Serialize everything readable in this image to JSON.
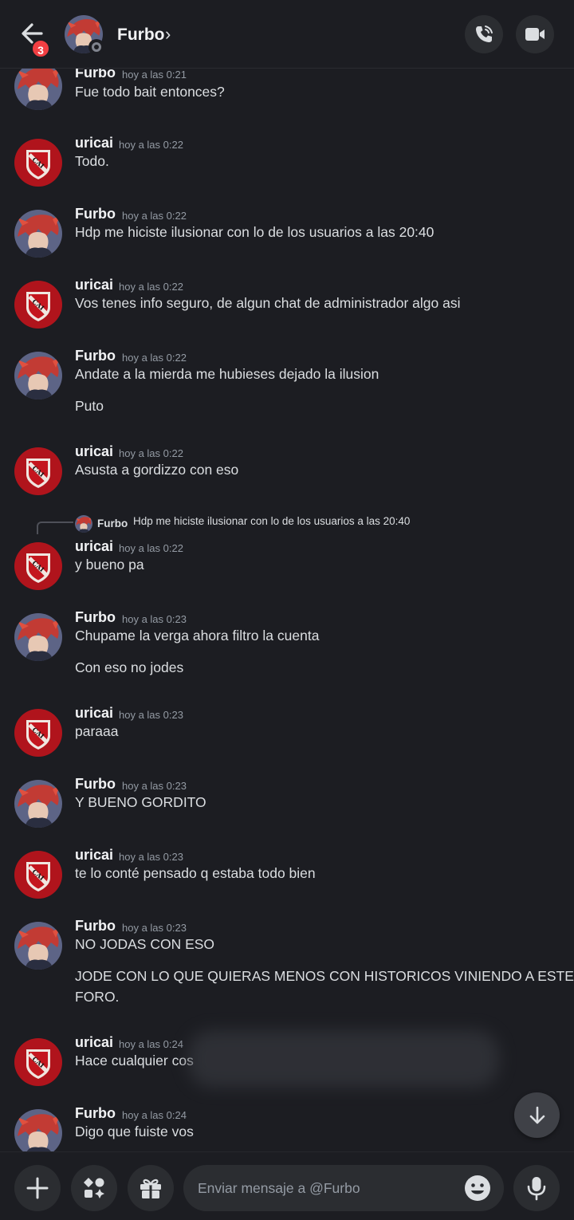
{
  "header": {
    "notification_count": "3",
    "name": "Furbo",
    "chevron": "›",
    "call_icon": "phone-call-icon",
    "video_icon": "video-camera-icon"
  },
  "reply": {
    "name": "Furbo",
    "text": "Hdp me hiciste ilusionar con lo de los usuarios a las 20:40"
  },
  "messages": [
    {
      "author": "Furbo",
      "time": "hoy a las 0:21",
      "lines": [
        "Fue todo bait entonces?"
      ]
    },
    {
      "author": "uricai",
      "time": "hoy a las 0:22",
      "lines": [
        "Todo."
      ]
    },
    {
      "author": "Furbo",
      "time": "hoy a las 0:22",
      "lines": [
        "Hdp me hiciste ilusionar con lo de los usuarios a las 20:40"
      ]
    },
    {
      "author": "uricai",
      "time": "hoy a las 0:22",
      "lines": [
        "Vos tenes info seguro,  de algun chat de administrador algo asi"
      ]
    },
    {
      "author": "Furbo",
      "time": "hoy a las 0:22",
      "lines": [
        "Andate a la mierda me hubieses dejado la ilusion",
        "Puto"
      ]
    },
    {
      "author": "uricai",
      "time": "hoy a las 0:22",
      "lines": [
        "Asusta a gordizzo con eso"
      ]
    },
    {
      "author": "uricai",
      "time": "hoy a las 0:22",
      "lines": [
        "y bueno pa"
      ]
    },
    {
      "author": "Furbo",
      "time": "hoy a las 0:23",
      "lines": [
        "Chupame la verga ahora filtro la cuenta",
        "Con eso no jodes"
      ]
    },
    {
      "author": "uricai",
      "time": "hoy a las 0:23",
      "lines": [
        "paraaa"
      ]
    },
    {
      "author": "Furbo",
      "time": "hoy a las 0:23",
      "lines": [
        "Y BUENO GORDITO"
      ]
    },
    {
      "author": "uricai",
      "time": "hoy a las 0:23",
      "lines": [
        "te lo conté pensado q estaba todo bien"
      ]
    },
    {
      "author": "Furbo",
      "time": "hoy a las 0:23",
      "lines": [
        "NO JODAS CON ESO",
        "JODE CON LO QUE QUIERAS MENOS CON HISTORICOS VINIENDO A ESTE",
        "FORO."
      ]
    },
    {
      "author": "uricai",
      "time": "hoy a las 0:24",
      "lines": [
        "Hace cualquier cos"
      ]
    },
    {
      "author": "Furbo",
      "time": "hoy a las 0:24",
      "lines": [
        "Digo que fuiste vos"
      ]
    }
  ],
  "composer": {
    "placeholder": "Enviar mensaje a @Furbo"
  },
  "colors": {
    "background": "#1c1d22",
    "surface": "#2b2d31",
    "badge": "#f23f43",
    "username": "#f2f3f5",
    "timestamp": "#949ba4"
  }
}
